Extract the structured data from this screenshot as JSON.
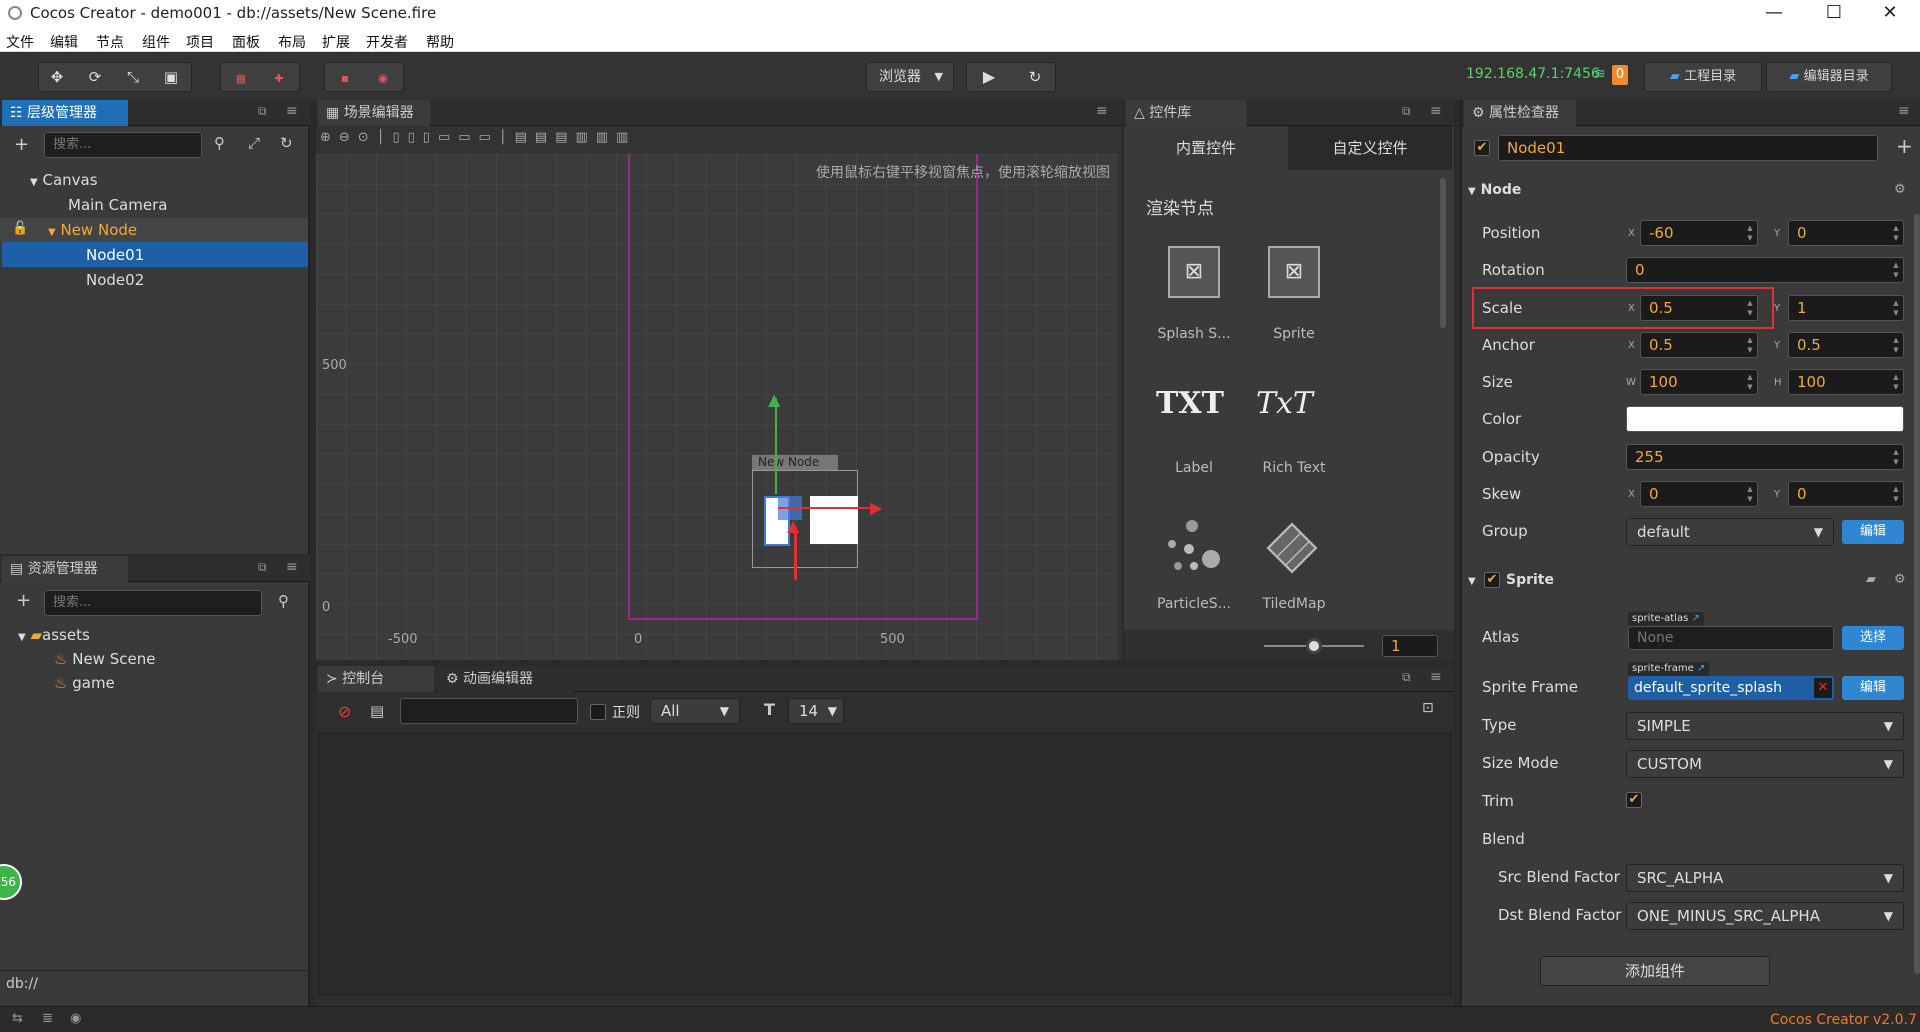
{
  "window": {
    "title": "Cocos Creator - demo001 - db://assets/New Scene.fire",
    "minimize": "—",
    "maximize": "☐",
    "close": "✕"
  },
  "menu": [
    "文件",
    "编辑",
    "节点",
    "组件",
    "项目",
    "面板",
    "布局",
    "扩展",
    "开发者",
    "帮助"
  ],
  "toolbar": {
    "browser_select": "浏览器",
    "ip": "192.168.47.1:7456",
    "badge": "0",
    "project_dir": "工程目录",
    "editor_dir": "编辑器目录"
  },
  "hierarchy": {
    "title": "层级管理器",
    "search_placeholder": "搜索...",
    "items": [
      "Canvas",
      "Main Camera",
      "New Node",
      "Node01",
      "Node02"
    ]
  },
  "assets": {
    "title": "资源管理器",
    "search_placeholder": "搜索...",
    "items": [
      "assets",
      "New Scene",
      "game"
    ],
    "footer": "db://"
  },
  "scene": {
    "title": "场景编辑器",
    "hint": "使用鼠标右键平移视窗焦点，使用滚轮缩放视图",
    "ruler_y": [
      "500",
      "0"
    ],
    "ruler_x": [
      "-500",
      "0",
      "500"
    ],
    "node_label": "New Node"
  },
  "widgets": {
    "title": "控件库",
    "tab_builtin": "内置控件",
    "tab_custom": "自定义控件",
    "section": "渲染节点",
    "items": [
      "Splash S...",
      "Sprite",
      "Label",
      "Rich Text",
      "ParticleS...",
      "TiledMap"
    ],
    "icon_txt1": "TXT",
    "icon_txt2": "TxT",
    "zoom_value": "1"
  },
  "console": {
    "tab_console": "控制台",
    "tab_anim": "动画编辑器",
    "regex_label": "正则",
    "filter": "All",
    "font_size": "14"
  },
  "inspector": {
    "title": "属性检查器",
    "node_name": "Node01",
    "node_section": "Node",
    "position": {
      "label": "Position",
      "x": "-60",
      "y": "0"
    },
    "rotation": {
      "label": "Rotation",
      "value": "0"
    },
    "scale": {
      "label": "Scale",
      "x": "0.5",
      "y": "1"
    },
    "anchor": {
      "label": "Anchor",
      "x": "0.5",
      "y": "0.5"
    },
    "size": {
      "label": "Size",
      "w": "100",
      "h": "100"
    },
    "color": {
      "label": "Color",
      "value": "#ffffff"
    },
    "opacity": {
      "label": "Opacity",
      "value": "255"
    },
    "skew": {
      "label": "Skew",
      "x": "0",
      "y": "0"
    },
    "group": {
      "label": "Group",
      "value": "default",
      "edit": "编辑"
    },
    "sprite_section": "Sprite",
    "atlas": {
      "label": "Atlas",
      "tag": "sprite-atlas",
      "value": "None",
      "button": "选择"
    },
    "sprite_frame": {
      "label": "Sprite Frame",
      "tag": "sprite-frame",
      "value": "default_sprite_splash",
      "button": "编辑"
    },
    "type": {
      "label": "Type",
      "value": "SIMPLE"
    },
    "size_mode": {
      "label": "Size Mode",
      "value": "CUSTOM"
    },
    "trim": {
      "label": "Trim"
    },
    "blend": {
      "label": "Blend"
    },
    "src_blend": {
      "label": "Src Blend Factor",
      "value": "SRC_ALPHA"
    },
    "dst_blend": {
      "label": "Dst Blend Factor",
      "value": "ONE_MINUS_SRC_ALPHA"
    },
    "add_component": "添加组件",
    "axis": {
      "x": "X",
      "y": "Y",
      "w": "W",
      "h": "H"
    }
  },
  "status": {
    "version": "Cocos Creator v2.0.7",
    "badge": "56"
  },
  "colors": {
    "accent": "#1e6fb8",
    "value_orange": "#f2a93b",
    "highlight_red": "#e03030"
  }
}
